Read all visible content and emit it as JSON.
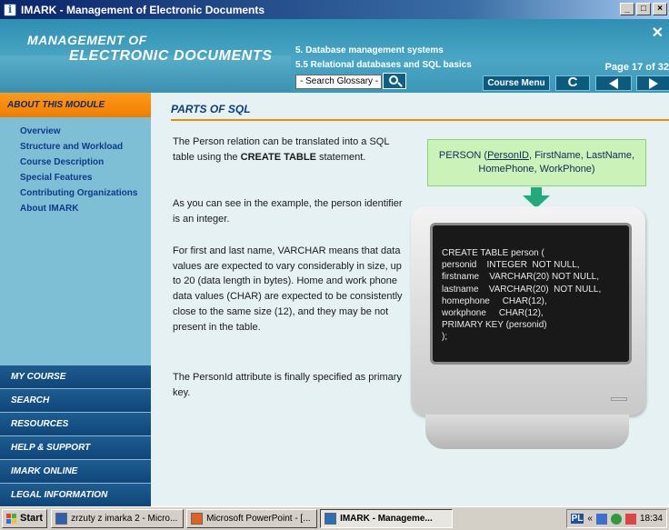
{
  "window": {
    "title": "IMARK - Management of Electronic Documents",
    "controls": [
      "_",
      "□",
      "×"
    ]
  },
  "header": {
    "title_line1": "MANAGEMENT OF",
    "title_line2": "ELECTRONIC DOCUMENTS",
    "breadcrumb_section": "5.   Database management systems",
    "breadcrumb_lesson": "5.5  Relational databases and SQL basics",
    "page": "Page 17 of 32",
    "glossary_placeholder": "- Search Glossary -",
    "course_menu_label": "Course Menu",
    "refresh_glyph": "C",
    "close_glyph": "✕",
    "colors": {
      "header": "#3d98b8",
      "button": "#0d5a7f"
    }
  },
  "sidebar": {
    "about_title": "ABOUT THIS MODULE",
    "about_items": [
      "Overview",
      "Structure and Workload",
      "Course Description",
      "Special Features",
      "Contributing Organizations",
      "About IMARK"
    ],
    "menus": [
      "MY COURSE",
      "SEARCH",
      "RESOURCES",
      "HELP & SUPPORT",
      "IMARK ONLINE",
      "LEGAL INFORMATION"
    ],
    "colors": {
      "about_head": "#f07d00",
      "menu": "#10467a"
    }
  },
  "main": {
    "section_title": "PARTS OF SQL",
    "p1_a": "The Person relation can be translated into a SQL table using the ",
    "p1_b": "CREATE TABLE",
    "p1_c": " statement.",
    "p2": "As you can see in the example, the person identifier is an integer.",
    "p3": "For first and last name, VARCHAR means that data values are expected to vary considerably in size, up to 20 (data length in bytes). Home and work phone data values (CHAR) are expected to be consistently close to the same size (12), and they may be not present in the table.",
    "p4": "The PersonId attribute is finally specified as primary key.",
    "callout": {
      "prefix": "PERSON (",
      "key": "PersonID",
      "rest": ", FirstName, LastName, HomePhone, WorkPhone)"
    },
    "code": "CREATE TABLE person (\npersonid    INTEGER  NOT NULL,\nfirstname    VARCHAR(20) NOT NULL,\nlastname    VARCHAR(20)  NOT NULL,\nhomephone     CHAR(12),\nworkphone     CHAR(12),\nPRIMARY KEY (personid)\n);"
  },
  "taskbar": {
    "start": "Start",
    "tasks": [
      {
        "label": "zrzuty z imarka 2 - Micro...",
        "icon": "word-icon"
      },
      {
        "label": "Microsoft PowerPoint - [...",
        "icon": "powerpoint-icon"
      },
      {
        "label": "IMARK - Manageme...",
        "icon": "imark-icon"
      }
    ],
    "tray_lang": "PL",
    "tray_arrows": "«",
    "clock": "18:34"
  }
}
